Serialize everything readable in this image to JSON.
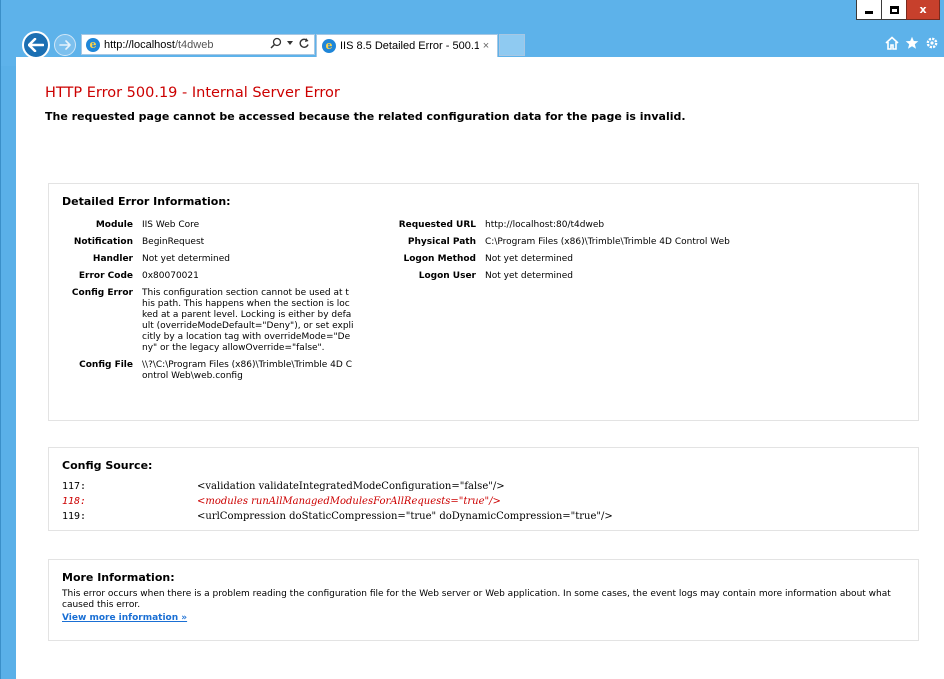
{
  "browser": {
    "address": {
      "host": "http://localhost",
      "path": "/t4dweb"
    },
    "tab": {
      "title": "IIS 8.5 Detailed Error - 500.1...",
      "close": "×"
    },
    "window_controls": {
      "close": "x"
    },
    "icons": [
      "back-arrow-icon",
      "forward-arrow-icon",
      "ie-logo-icon",
      "search-icon",
      "refresh-icon",
      "home-icon",
      "favorites-star-icon",
      "settings-gear-icon"
    ]
  },
  "page": {
    "title": "HTTP Error 500.19 - Internal Server Error",
    "subtitle": "The requested page cannot be accessed because the related configuration data for the page is invalid.",
    "details": {
      "heading": "Detailed Error Information:",
      "left": [
        {
          "label": "Module",
          "value": "IIS Web Core"
        },
        {
          "label": "Notification",
          "value": "BeginRequest"
        },
        {
          "label": "Handler",
          "value": "Not yet determined"
        },
        {
          "label": "Error Code",
          "value": "0x80070021"
        },
        {
          "label": "Config Error",
          "value": "This configuration section cannot be used at this path. This happens when the section is locked at a parent level. Locking is either by default (overrideModeDefault=\"Deny\"), or set explicitly by a location tag with overrideMode=\"Deny\" or the legacy allowOverride=\"false\"."
        },
        {
          "label": "Config File",
          "value": "\\\\?\\C:\\Program Files (x86)\\Trimble\\Trimble 4D Control Web\\web.config"
        }
      ],
      "right": [
        {
          "label": "Requested URL",
          "value": "http://localhost:80/t4dweb"
        },
        {
          "label": "Physical Path",
          "value": "C:\\Program Files (x86)\\Trimble\\Trimble 4D Control Web"
        },
        {
          "label": "Logon Method",
          "value": "Not yet determined"
        },
        {
          "label": "Logon User",
          "value": "Not yet determined"
        }
      ]
    },
    "config_source": {
      "heading": "Config Source:",
      "lines": [
        {
          "num": "117:",
          "code": "<validation validateIntegratedModeConfiguration=\"false\"/>"
        },
        {
          "num": "118:",
          "code": "<modules runAllManagedModulesForAllRequests=\"true\"/>"
        },
        {
          "num": "119:",
          "code": "<urlCompression doStaticCompression=\"true\" doDynamicCompression=\"true\"/>"
        }
      ]
    },
    "more_info": {
      "heading": "More Information:",
      "text": "This error occurs when there is a problem reading the configuration file for the Web server or Web application. In some cases, the event logs may contain more information about what caused this error.",
      "link": "View more information »"
    }
  },
  "colors": {
    "error_red": "#cc0000",
    "link_blue": "#1a6fd4",
    "chrome_blue": "#5db2ea"
  }
}
